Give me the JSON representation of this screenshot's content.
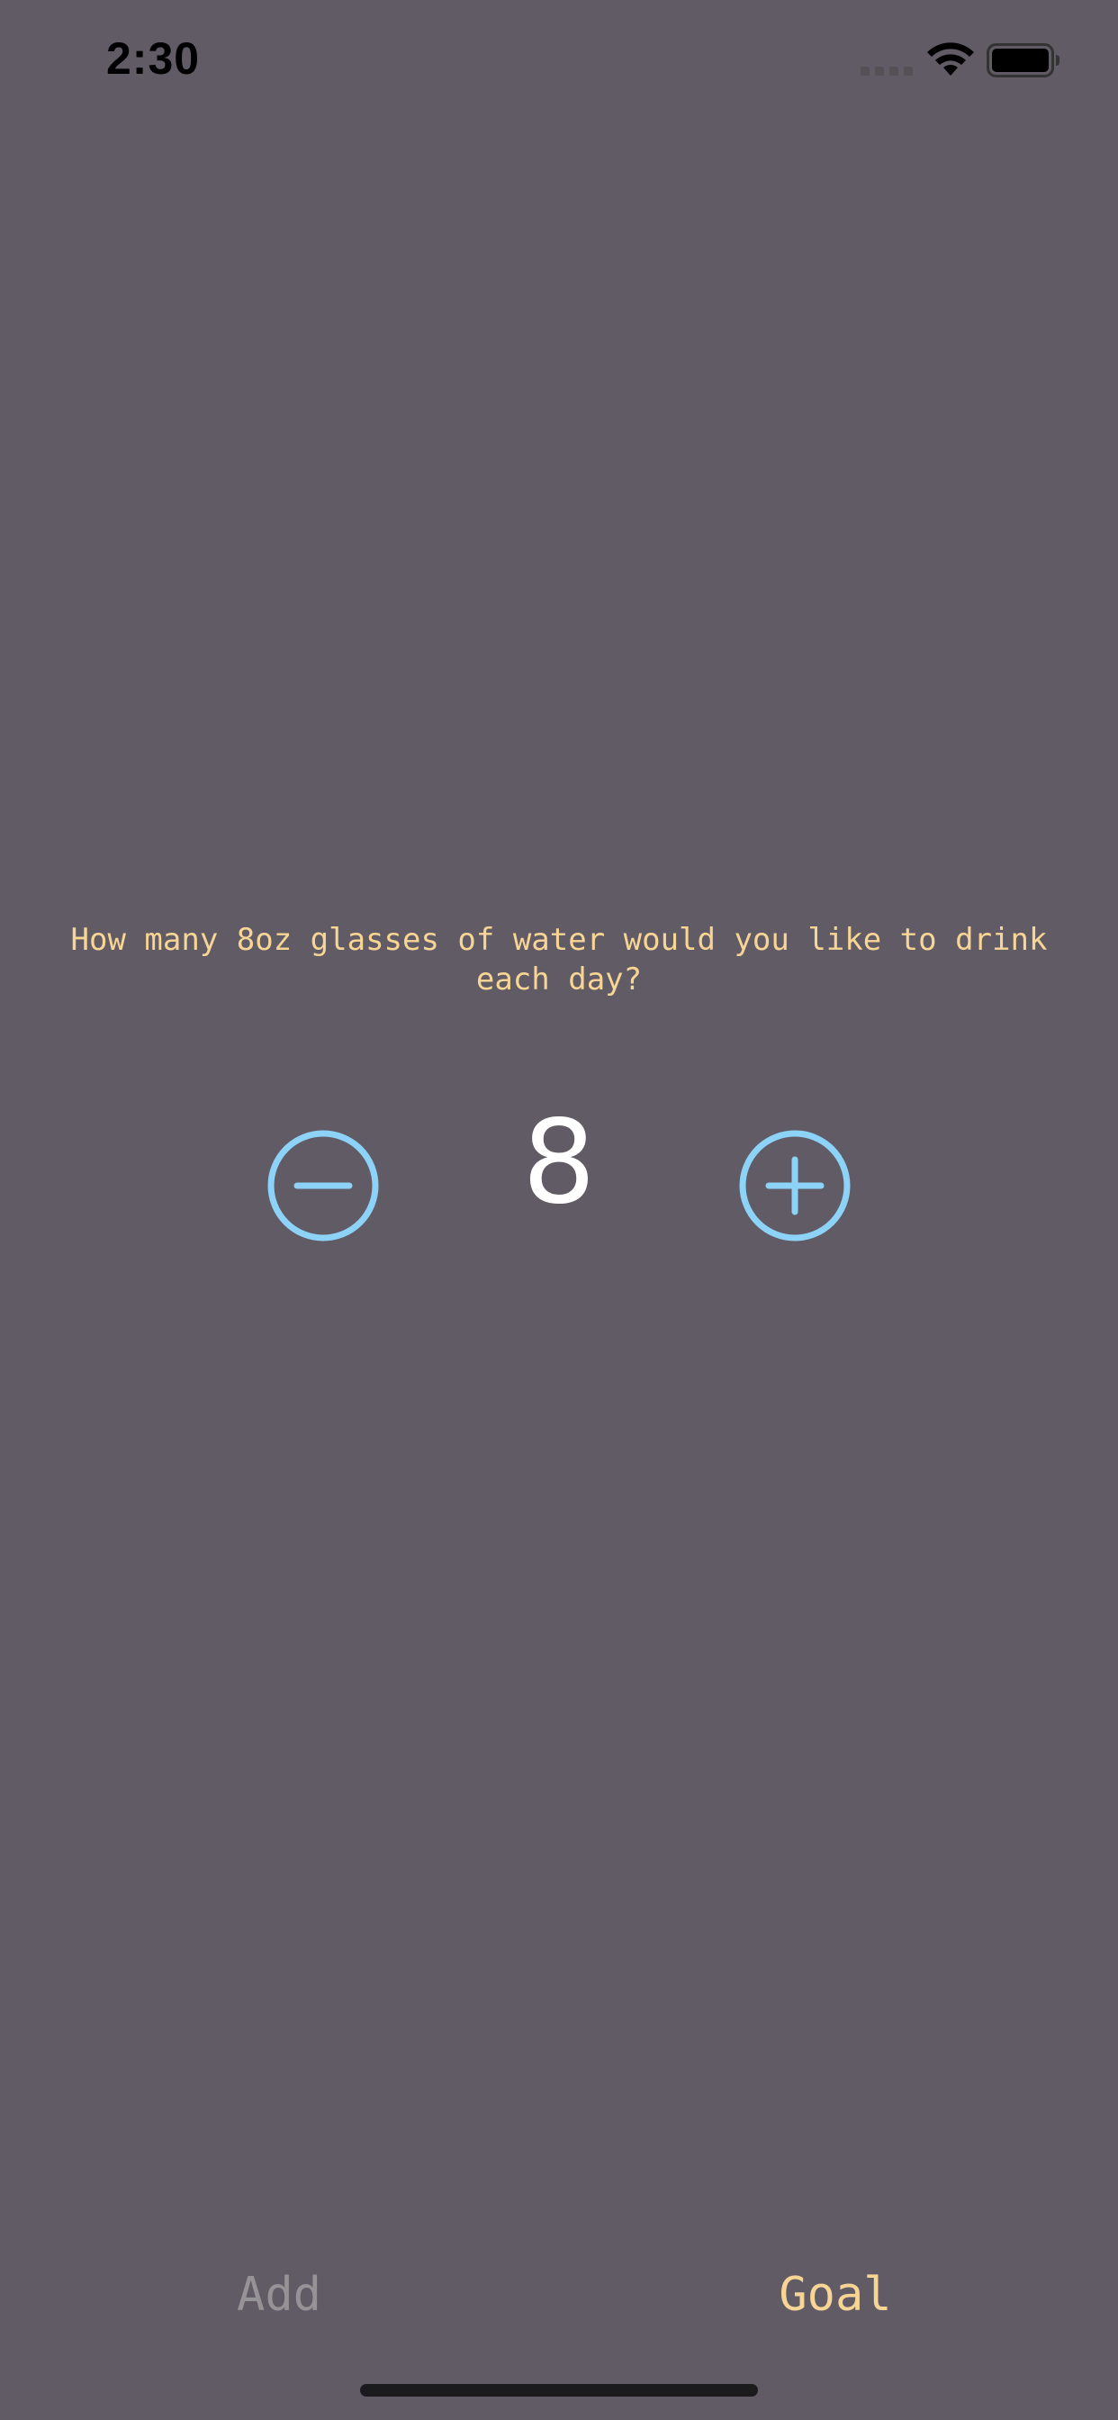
{
  "status_bar": {
    "time": "2:30",
    "icons": [
      "cellular-signal-icon",
      "wifi-icon",
      "battery-icon"
    ]
  },
  "goal": {
    "prompt": "How many 8oz glasses of water would you like to drink each day?",
    "value": "8",
    "decrement_icon": "minus-circle-icon",
    "increment_icon": "plus-circle-icon"
  },
  "tab_bar": {
    "tabs": [
      {
        "label": "Add",
        "selected": false
      },
      {
        "label": "Goal",
        "selected": true
      }
    ]
  },
  "colors": {
    "background": "#615b66",
    "accent": "#f7d595",
    "button": "#8dd3f7",
    "inactive_tab": "#969396",
    "value": "#ffffff"
  }
}
